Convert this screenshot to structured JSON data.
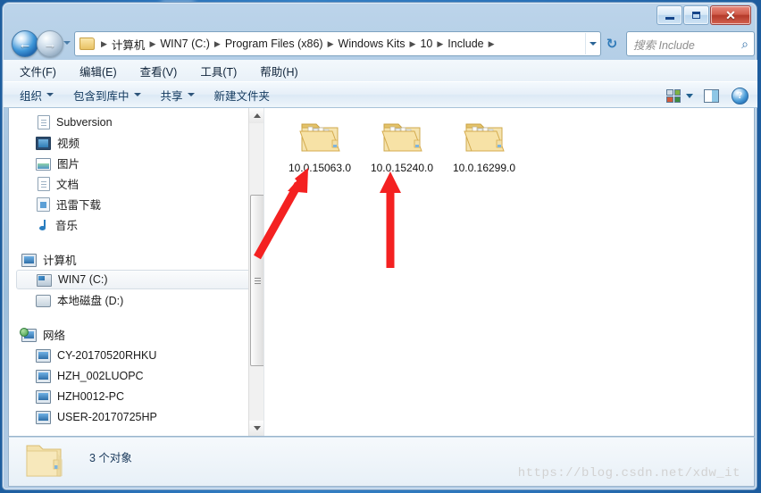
{
  "window": {
    "minimize_label": "—",
    "maximize_label": "□",
    "close_label": "✕"
  },
  "nav": {
    "back_glyph": "←",
    "forward_glyph": "→",
    "refresh_glyph": "↻",
    "breadcrumbs": [
      "计算机",
      "WIN7 (C:)",
      "Program Files (x86)",
      "Windows Kits",
      "10",
      "Include"
    ],
    "separator": "▶"
  },
  "search": {
    "placeholder": "搜索 Include",
    "icon_glyph": "⌕"
  },
  "menubar": {
    "items": [
      {
        "label": "文件(F)"
      },
      {
        "label": "编辑(E)"
      },
      {
        "label": "查看(V)"
      },
      {
        "label": "工具(T)"
      },
      {
        "label": "帮助(H)"
      }
    ]
  },
  "commandbar": {
    "items": [
      {
        "label": "组织",
        "caret": true
      },
      {
        "label": "包含到库中",
        "caret": true
      },
      {
        "label": "共享",
        "caret": true
      },
      {
        "label": "新建文件夹",
        "caret": false
      }
    ],
    "help_label": "?"
  },
  "sidebar": {
    "items": [
      {
        "label": "Subversion",
        "icon": "document-icon",
        "type": "item"
      },
      {
        "label": "视频",
        "icon": "video-icon",
        "type": "item"
      },
      {
        "label": "图片",
        "icon": "picture-icon",
        "type": "item"
      },
      {
        "label": "文档",
        "icon": "document-icon",
        "type": "item"
      },
      {
        "label": "迅雷下载",
        "icon": "download-icon",
        "type": "item"
      },
      {
        "label": "音乐",
        "icon": "music-icon",
        "type": "item"
      },
      {
        "label": "计算机",
        "icon": "computer-icon",
        "type": "section"
      },
      {
        "label": "WIN7 (C:)",
        "icon": "drive-icon",
        "type": "item",
        "selected": true
      },
      {
        "label": "本地磁盘 (D:)",
        "icon": "disk-icon",
        "type": "item"
      },
      {
        "label": "网络",
        "icon": "network-icon",
        "type": "section"
      },
      {
        "label": "CY-20170520RHKU",
        "icon": "computer-icon",
        "type": "item"
      },
      {
        "label": "HZH_002LUOPC",
        "icon": "computer-icon",
        "type": "item"
      },
      {
        "label": "HZH0012-PC",
        "icon": "computer-icon",
        "type": "item"
      },
      {
        "label": "USER-20170725HP",
        "icon": "computer-icon",
        "type": "item"
      }
    ]
  },
  "content": {
    "folders": [
      {
        "name": "10.0.15063.0"
      },
      {
        "name": "10.0.15240.0"
      },
      {
        "name": "10.0.16299.0"
      }
    ]
  },
  "statusbar": {
    "item_count_label": "3 个对象"
  },
  "watermark": {
    "text": "https://blog.csdn.net/xdw_it"
  },
  "colors": {
    "accent": "#1c5a9e",
    "close_button": "#b43a2a",
    "folder_yellow": "#f0d596",
    "annotation_red": "#f42121"
  }
}
